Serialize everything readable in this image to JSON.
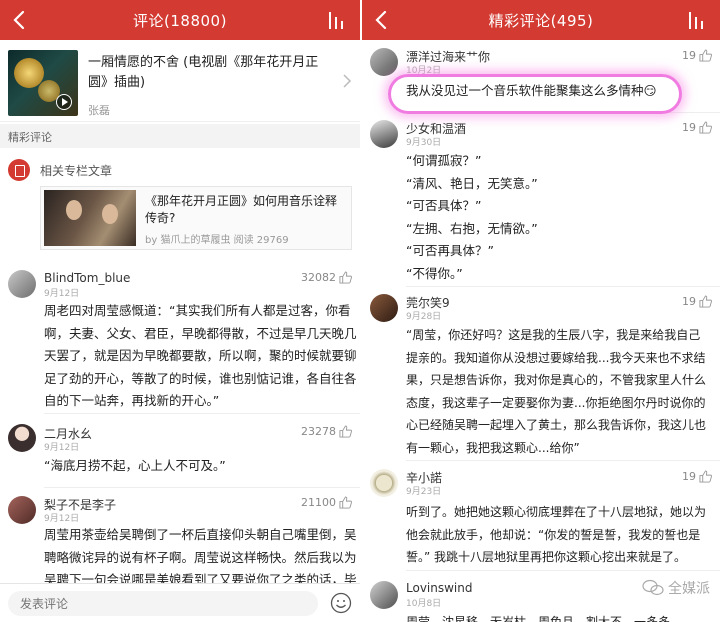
{
  "left": {
    "nav_title": "评论(18800)",
    "song": {
      "title": "一厢情愿的不舍 (电视剧《那年花开月正圆》插曲)",
      "artist": "张磊"
    },
    "section_label": "精彩评论",
    "article": {
      "label": "相关专栏文章",
      "title": "《那年花开月正圆》如何用音乐诠释传奇?",
      "meta": "by 猫爪上的草履虫  阅读 29769"
    },
    "comments": [
      {
        "user": "BlindTom_blue",
        "date": "9月12日",
        "likes": "32082",
        "lines": [
          "周老四对周莹感慨道：“其实我们所有人都是过客，你看",
          "啊，夫妻、父女、君臣，早晚都得散，不过是早几天晚几",
          "天罢了，就是因为早晚都要散，所以啊，聚的时候就要铆",
          "足了劲的开心，等散了的时候，谁也别惦记谁，各自往各",
          "自的下一站奔，再找新的开心。”"
        ]
      },
      {
        "user": "二月水幺",
        "date": "9月12日",
        "likes": "23278",
        "lines": [
          "“海底月捞不起，心上人不可及。”"
        ]
      },
      {
        "user": "梨子不是李子",
        "date": "9月12日",
        "likes": "21100",
        "lines": [
          "周莹用茶壶给吴聘倒了一杯后直接仰头朝自己嘴里倒，吴",
          "聘略微诧异的说有杯子啊。周莹说这样畅快。然后我以为",
          "吴聘下一句会说哪是美娘看到了又要说你了之类的话，毕"
        ]
      }
    ],
    "input_placeholder": "发表评论"
  },
  "right": {
    "nav_title": "精彩评论(495)",
    "comments": [
      {
        "user": "漂洋过海来艹你",
        "date": "10月2日",
        "likes": "19",
        "lines": [
          "我从没见过一个音乐软件能聚集这么多情种😏"
        ]
      },
      {
        "user": "少女和温酒",
        "date": "9月30日",
        "likes": "19",
        "lines": [
          "“何谓孤寂？”",
          "“清风、艳日，无笑意。”",
          "“可否具体？”",
          "“左拥、右抱，无情欲。”",
          "“可否再具体？”",
          "“不得你。”"
        ]
      },
      {
        "user": "莞尔笑9",
        "date": "9月28日",
        "likes": "19",
        "lines": [
          "“周莹，你还好吗？这是我的生辰八字，我是来给我自己",
          "提亲的。我知道你从没想过要嫁给我...我今天来也不求结",
          "果，只是想告诉你，我对你是真心的，不管我家里人什么",
          "态度，我这辈子一定要娶你为妻...你拒绝图尔丹时说你的",
          "心已经随吴聘一起埋入了黄土，那么我告诉你，我这儿也",
          "有一颗心，我把我这颗心...给你”"
        ]
      },
      {
        "user": "辛小諾",
        "date": "9月23日",
        "likes": "19",
        "lines": [
          "听到了。她把她这颗心彻底埋葬在了十八层地狱，她以为",
          "他会就此放手，他却说：“你发的誓是誓，我发的誓也是",
          "誓。” 我跳十八层地狱里再把你这颗心挖出来就是了。"
        ]
      },
      {
        "user": "Lovinswind",
        "date": "10月8日",
        "likes": "",
        "lines": [
          "周莹、沈星移，无岁枯，周免且，割大不，一多多"
        ]
      }
    ],
    "watermark": "全媒派"
  },
  "colors": {
    "accent": "#d33a31",
    "highlight": "#f07ce2"
  }
}
